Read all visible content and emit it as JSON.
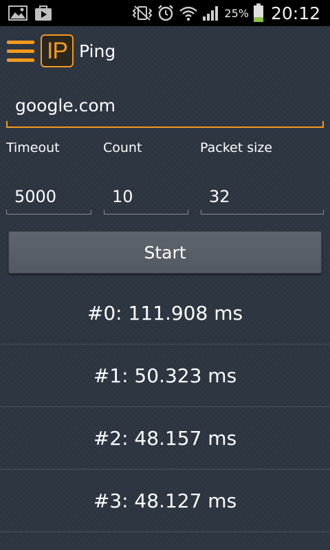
{
  "status_bar": {
    "battery": "25%",
    "time": "20:12",
    "icons": [
      "gallery-icon",
      "play-store-icon",
      "vibrate-icon",
      "alarm-icon",
      "wifi-icon",
      "signal-icon",
      "battery-icon"
    ]
  },
  "action_bar": {
    "logo_text": "IP",
    "title": "Ping"
  },
  "form": {
    "host_value": "google.com",
    "timeout_label": "Timeout",
    "count_label": "Count",
    "packet_size_label": "Packet size",
    "timeout_value": "5000",
    "count_value": "10",
    "packet_size_value": "32",
    "start_label": "Start"
  },
  "results": [
    "#0: 111.908 ms",
    "#1: 50.323 ms",
    "#2: 48.157 ms",
    "#3: 48.127 ms"
  ],
  "colors": {
    "accent": "#f39a1e",
    "background": "#2c3440",
    "button": "#5a6067"
  }
}
